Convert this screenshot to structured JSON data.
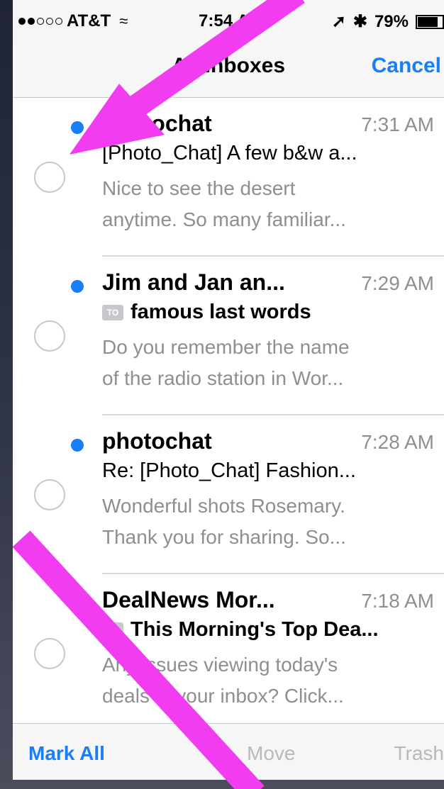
{
  "status_bar": {
    "carrier": "AT&T",
    "time": "7:54 AM",
    "battery": "79%",
    "battery_level": 0.79,
    "signal_bars": 2
  },
  "nav": {
    "title": "All Inboxes",
    "cancel": "Cancel"
  },
  "messages": [
    {
      "sender": "photochat",
      "time": "7:31 AM",
      "subject": "[Photo_Chat] A few b&w a...",
      "preview_line1": "Nice to see the desert",
      "preview_line2": "anytime. So many familiar..."
    },
    {
      "sender": "Jim and Jan an...",
      "time": "7:29 AM",
      "subject": "famous last words",
      "badge": "TO",
      "preview_line1": "Do you remember the name",
      "preview_line2": "of the radio station in Wor..."
    },
    {
      "sender": "photochat",
      "time": "7:28 AM",
      "subject": "Re: [Photo_Chat] Fashion...",
      "preview_line1": "Wonderful shots Rosemary.",
      "preview_line2": "Thank you for sharing. So..."
    },
    {
      "sender": "DealNews Mor...",
      "time": "7:18 AM",
      "subject": "This Morning's Top Dea...",
      "badge": "TO",
      "preview_line1": "Any issues viewing today's",
      "preview_line2": "deals in your inbox? Click..."
    }
  ],
  "toolbar": {
    "mark_all": "Mark All",
    "move": "Move",
    "trash": "Trash"
  },
  "colors": {
    "accent": "#1a7efb",
    "arrow": "#f23cf0",
    "muted": "#8e8e93"
  }
}
